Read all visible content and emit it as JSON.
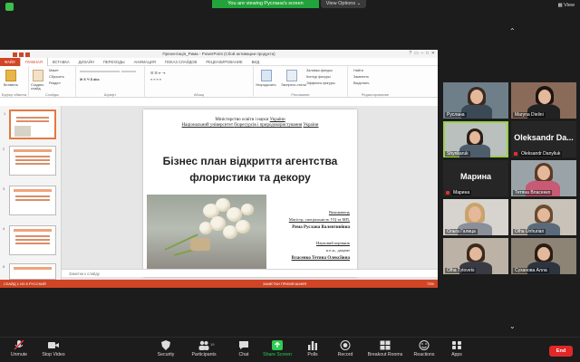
{
  "topbar": {
    "viewing_text": "You are viewing Руслана's screen",
    "view_options": "View Options ⌄",
    "view_label": "View"
  },
  "ppt": {
    "window_title": "Презентація_Рима - PowerPoint (Сбой активации продукта)",
    "tabs": [
      "ФАЙЛ",
      "ГЛАВНАЯ",
      "ВСТАВКА",
      "ДИЗАЙН",
      "ПЕРЕХОДЫ",
      "АНИМАЦИЯ",
      "ПОКАЗ СЛАЙДОВ",
      "РЕЦЕНЗИРОВАНИЕ",
      "ВИД"
    ],
    "ribbon_groups": [
      "Буфер обмена",
      "Слайды",
      "Шрифт",
      "Абзац",
      "Рисование",
      "Редактирование"
    ],
    "ribbon_items": {
      "paste": "Вставить",
      "create_slide": "Создать слайд",
      "layout": "Макет",
      "reset": "Сбросить",
      "section": "Раздел",
      "arrange": "Упорядочить",
      "express_styles": "Экспресс-стили",
      "shape_fill": "Заливка фигуры",
      "shape_outline": "Контур фигуры",
      "shape_effects": "Эффекты фигуры",
      "find": "Найти",
      "replace": "Заменить",
      "select": "Выделить"
    },
    "slide": {
      "line1_prefix": "Міністерство освіти і науки ",
      "line1_link": "України",
      "line2_prefix": "Національний університет ",
      "line2_link1": "біоресурсів",
      "line2_mid": " і ",
      "line2_link2": "природокористування",
      "line2_suffix": " ",
      "line2_link3": "України",
      "title_line1": "Бізнес план відкриття агентства",
      "title_line2": "флористики та декору",
      "r1": "Виконавець",
      "r2": "Магістр, спеціальність УЦ та МП,",
      "r3": "Ряма Руслана Валентинівна",
      "r4": "Науковий керівник",
      "r5": "к.е.н., доцент",
      "r6": "Власенко Тетяна Олексіївна"
    },
    "notes_placeholder": "Заметки к слайду",
    "status_left": "СЛАЙД 1 ИЗ 8   РУССКИЙ",
    "status_mid": "ЗАМЕТКИ   ПРИМЕЧАНИЯ",
    "status_right": "73%",
    "thumb_numbers": [
      "1",
      "2",
      "3",
      "4",
      "5"
    ]
  },
  "participants": [
    {
      "name": "Руслана",
      "kind": "video"
    },
    {
      "name": "Maryna Dielini",
      "kind": "video"
    },
    {
      "name": "Shynkaruk",
      "kind": "video",
      "speaker": true
    },
    {
      "name": "Oleksandr Danyliuk",
      "kind": "name",
      "big": "Oleksandr Da..."
    },
    {
      "name": "Марина",
      "kind": "name",
      "big": "Марина"
    },
    {
      "name": "Тетяна Власенко",
      "kind": "video"
    },
    {
      "name": "Ольга Галица",
      "kind": "video"
    },
    {
      "name": "Olha Unhurian",
      "kind": "video"
    },
    {
      "name": "Olha Tytovets",
      "kind": "video"
    },
    {
      "name": "Суханова Алла",
      "kind": "video"
    }
  ],
  "toolbar": {
    "unmute": "Unmute",
    "stop_video": "Stop Video",
    "security": "Security",
    "participants": "Participants",
    "participants_count": "19",
    "chat": "Chat",
    "share_screen": "Share Screen",
    "polls": "Polls",
    "record": "Record",
    "breakout": "Breakout Rooms",
    "reactions": "Reactions",
    "apps": "Apps",
    "end": "End"
  }
}
